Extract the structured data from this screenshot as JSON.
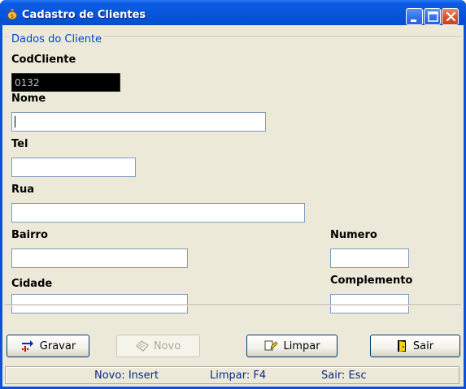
{
  "window": {
    "title": "Cadastro de Clientes"
  },
  "form": {
    "group_title": "Dados do Cliente",
    "fields": {
      "codcliente": {
        "label": "CodCliente",
        "value": "0132"
      },
      "nome": {
        "label": "Nome",
        "value": ""
      },
      "tel": {
        "label": "Tel",
        "value": ""
      },
      "rua": {
        "label": "Rua",
        "value": ""
      },
      "bairro": {
        "label": "Bairro",
        "value": ""
      },
      "numero": {
        "label": "Numero",
        "value": ""
      },
      "cidade": {
        "label": "Cidade",
        "value": ""
      },
      "complemento": {
        "label": "Complemento",
        "value": ""
      }
    }
  },
  "buttons": {
    "gravar": "Gravar",
    "novo": "Novo",
    "limpar": "Limpar",
    "sair": "Sair"
  },
  "statusbar": {
    "novo": "Novo: Insert",
    "limpar": "Limpar: F4",
    "sair": "Sair: Esc"
  }
}
